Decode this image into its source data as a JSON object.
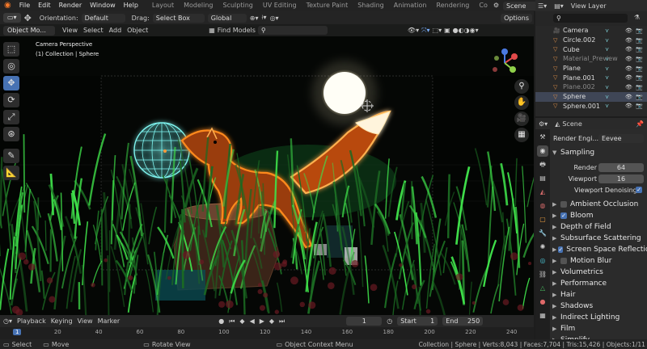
{
  "menu": {
    "items": [
      "File",
      "Edit",
      "Render",
      "Window",
      "Help"
    ],
    "workspaces": [
      "Layout",
      "Modeling",
      "Sculpting",
      "UV Editing",
      "Texture Paint",
      "Shading",
      "Animation",
      "Rendering",
      "Co"
    ],
    "scene": "Scene",
    "view_layer": "View Layer"
  },
  "viewport": {
    "orientation_label": "Orientation:",
    "orientation_value": "Default",
    "drag_label": "Drag:",
    "drag_value": "Select Box",
    "transform_value": "Global",
    "options": "Options",
    "mode": "Object Mo...",
    "menus": [
      "View",
      "Select",
      "Add",
      "Object"
    ],
    "find_models": "Find Models",
    "overlay_title": "Camera Perspective",
    "overlay_sub": "(1) Collection | Sphere"
  },
  "toolbar": {
    "tools": [
      "select-box",
      "cursor",
      "move",
      "rotate",
      "scale",
      "transform",
      "annotate",
      "measure"
    ]
  },
  "timeline": {
    "playback": "Playback",
    "keying": "Keying",
    "view": "View",
    "marker": "Marker",
    "current_frame": "1",
    "start_label": "Start",
    "start": "1",
    "end_label": "End",
    "end": "250",
    "ticks": [
      "1",
      "20",
      "40",
      "60",
      "80",
      "100",
      "120",
      "140",
      "160",
      "180",
      "200",
      "220",
      "240"
    ]
  },
  "status": {
    "select": "Select",
    "move": "Move",
    "rotate": "Rotate View",
    "context": "Object Context Menu",
    "stats": "Collection | Sphere | Verts:8,043 | Faces:7,704 | Tris:15,426 | Objects:1/11"
  },
  "outliner": {
    "rows": [
      {
        "name": "Camera",
        "dim": false,
        "sel": false
      },
      {
        "name": "Circle.002",
        "dim": false,
        "sel": false
      },
      {
        "name": "Cube",
        "dim": false,
        "sel": false
      },
      {
        "name": "Material_Preview",
        "dim": true,
        "sel": false
      },
      {
        "name": "Plane",
        "dim": false,
        "sel": false
      },
      {
        "name": "Plane.001",
        "dim": false,
        "sel": false
      },
      {
        "name": "Plane.002",
        "dim": true,
        "sel": false
      },
      {
        "name": "Sphere",
        "dim": false,
        "sel": true
      },
      {
        "name": "Sphere.001",
        "dim": false,
        "sel": false
      }
    ]
  },
  "properties": {
    "context": "Scene",
    "render_engine_label": "Render Engi...",
    "render_engine": "Eevee",
    "sampling": "Sampling",
    "render_label": "Render",
    "render_value": "64",
    "viewport_label": "Viewport",
    "viewport_value": "16",
    "viewport_denoising": "Viewport Denoising",
    "sections": [
      {
        "name": "Ambient Occlusion",
        "check": true,
        "on": false
      },
      {
        "name": "Bloom",
        "check": true,
        "on": true
      },
      {
        "name": "Depth of Field",
        "check": false,
        "on": false
      },
      {
        "name": "Subsurface Scattering",
        "check": false,
        "on": false
      },
      {
        "name": "Screen Space Reflectio",
        "check": true,
        "on": true
      },
      {
        "name": "Motion Blur",
        "check": true,
        "on": false
      },
      {
        "name": "Volumetrics",
        "check": false,
        "on": false
      },
      {
        "name": "Performance",
        "check": false,
        "on": false
      },
      {
        "name": "Hair",
        "check": false,
        "on": false
      },
      {
        "name": "Shadows",
        "check": false,
        "on": false
      },
      {
        "name": "Indirect Lighting",
        "check": false,
        "on": false
      },
      {
        "name": "Film",
        "check": false,
        "on": false
      },
      {
        "name": "Simplify",
        "check": false,
        "on": false
      }
    ]
  },
  "colors": {
    "accent": "#4772b3",
    "fox_glow": "#ff8a1e",
    "globe": "#7ff5f0",
    "grass": "#3fe04a",
    "moon": "#fffbe8"
  }
}
